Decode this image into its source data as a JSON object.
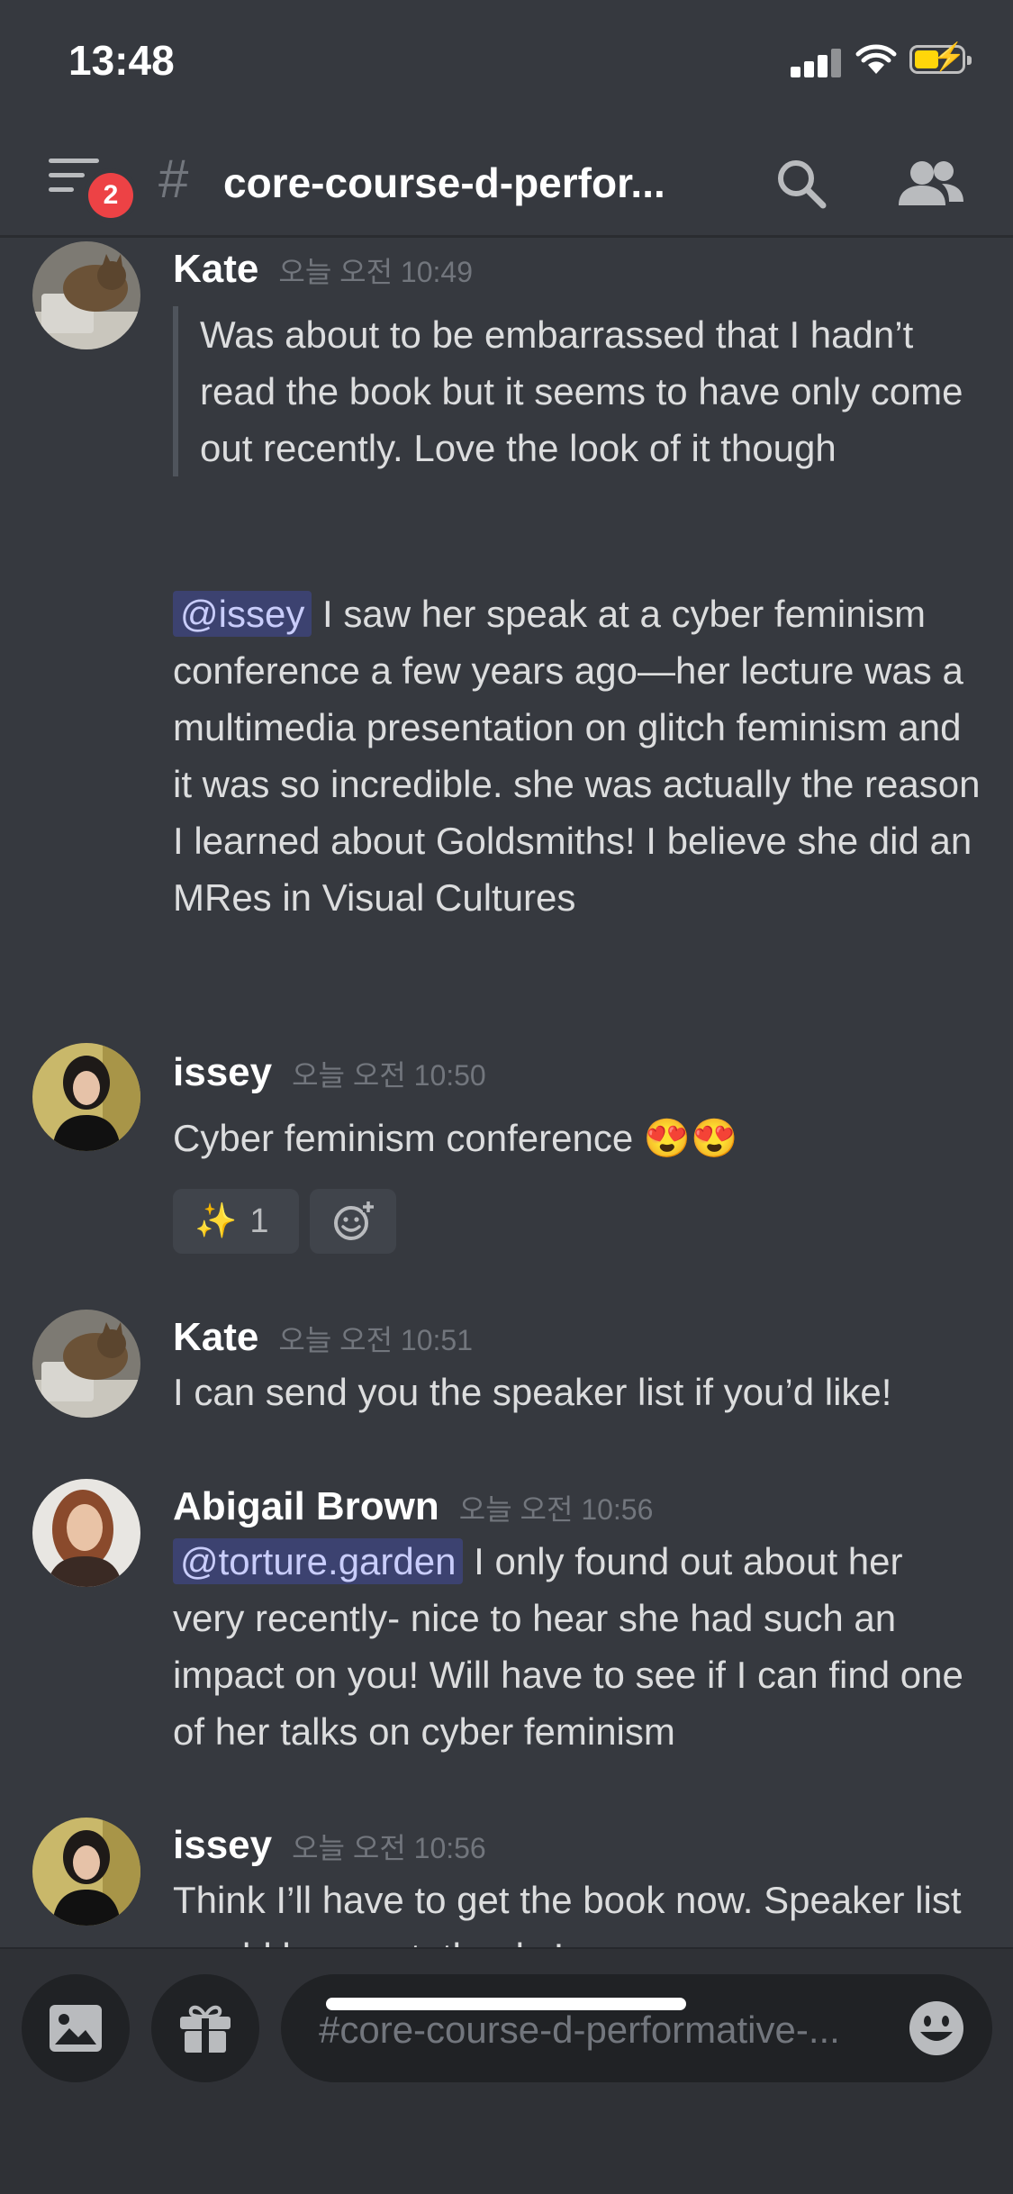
{
  "status_bar": {
    "time": "13:48"
  },
  "header": {
    "unread_badge": "2",
    "hash_symbol": "#",
    "channel_title": "core-course-d-perfor..."
  },
  "messages": [
    {
      "author": "Kate",
      "timestamp": "오늘 오전 10:49",
      "quote": "Was about to be embarrassed that I hadn’t read the book but it seems to have only come out recently. Love the look of it though",
      "mention": "@issey",
      "text": " I saw her speak at a cyber feminism conference a few years ago—her lecture was a multimedia presentation on glitch feminism and it was so incredible. she was actually the reason I learned about Goldsmiths! I believe she did an MRes in Visual Cultures"
    },
    {
      "author": "issey",
      "timestamp": "오늘 오전 10:50",
      "text": "Cyber feminism conference 😍😍",
      "reaction": {
        "emoji": "✨",
        "count": "1"
      }
    },
    {
      "author": "Kate",
      "timestamp": "오늘 오전 10:51",
      "text": "I can send you the speaker list if you’d like!"
    },
    {
      "author": "Abigail Brown",
      "timestamp": "오늘 오전 10:56",
      "mention": "@torture.garden",
      "text": " I only found out about her very recently- nice to hear she had such an impact on you! Will have to see if I can find one of her talks on cyber feminism"
    },
    {
      "author": "issey",
      "timestamp": "오늘 오전 10:56",
      "text": "Think I’ll have to get the book now. Speaker list would be great, thanks!"
    }
  ],
  "composer": {
    "placeholder": "#core-course-d-performative-..."
  },
  "colors": {
    "background": "#36393f",
    "composer_bg": "#2f3136",
    "mention_bg": "#3c4270",
    "badge_red": "#ed4245"
  }
}
